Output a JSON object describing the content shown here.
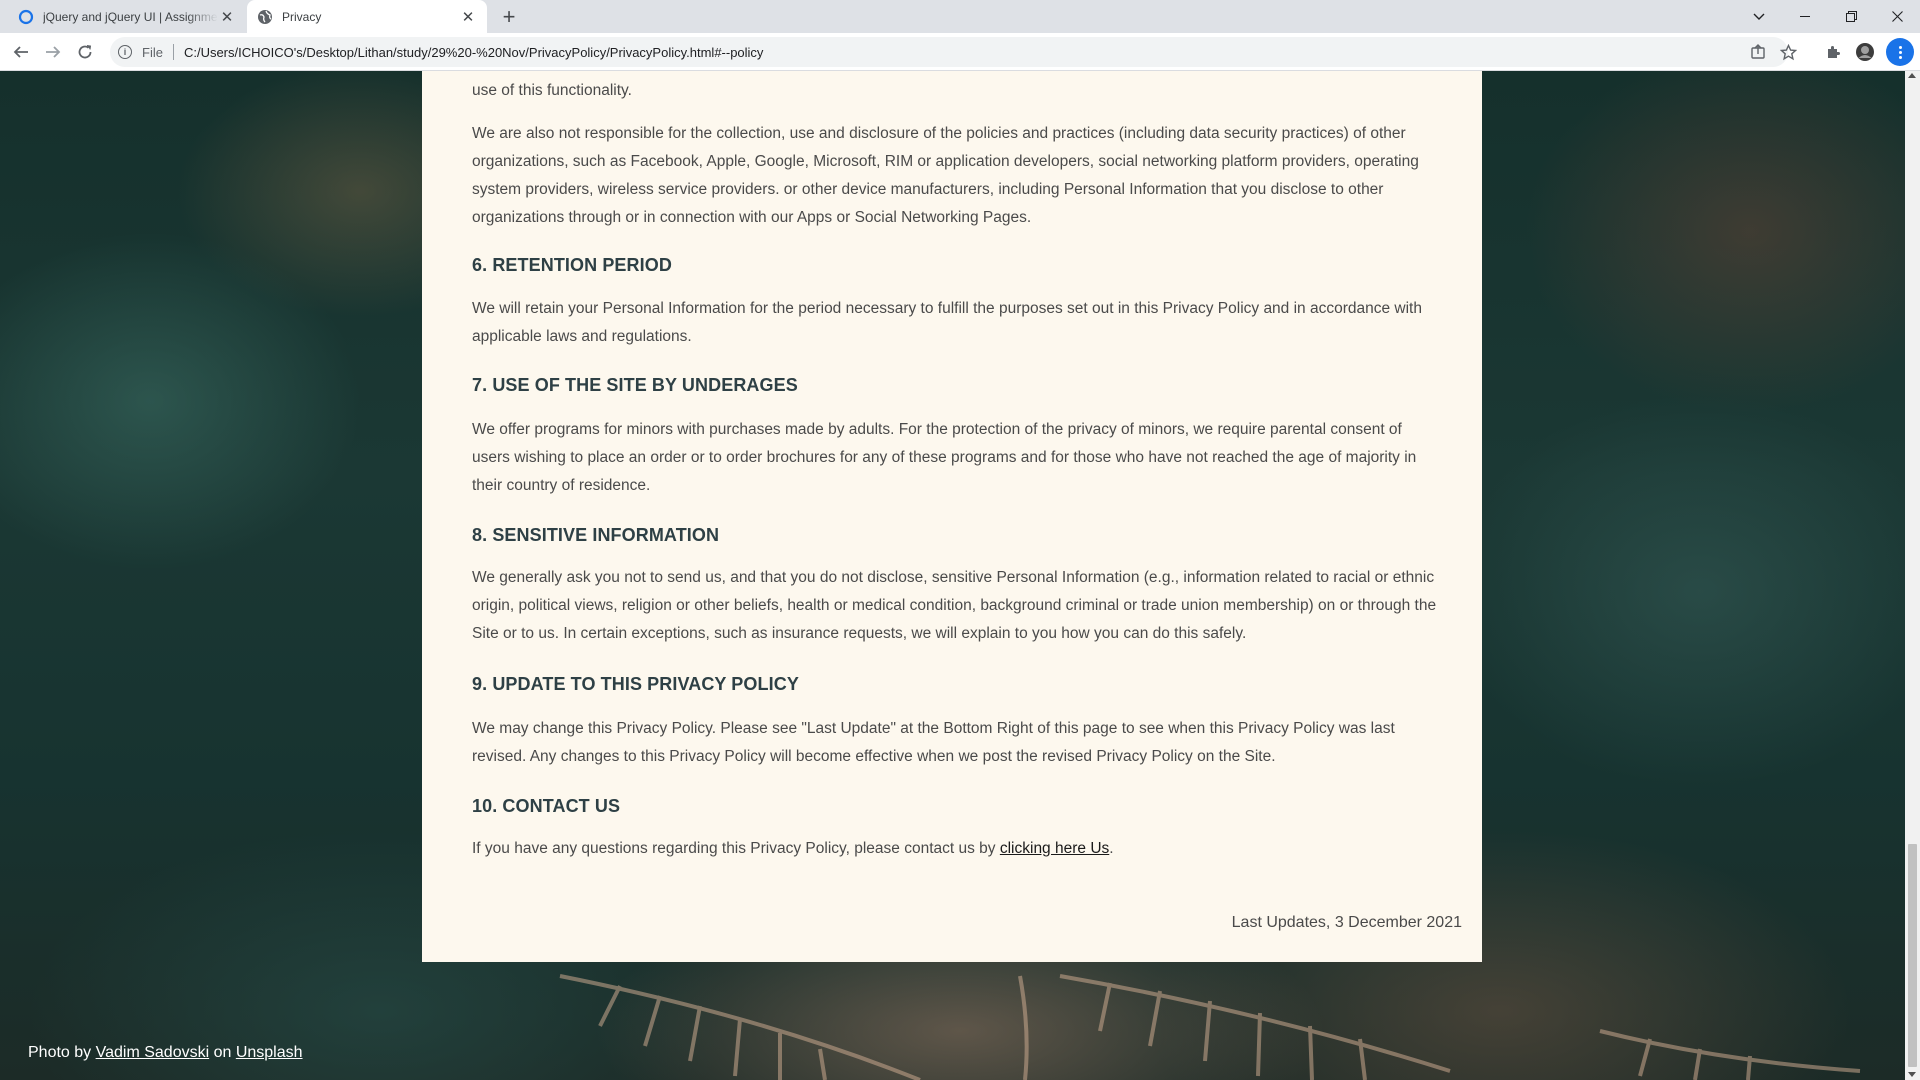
{
  "browser": {
    "tabs": [
      {
        "title": "jQuery and jQuery UI | Assignment",
        "icon": "circle-logo-icon",
        "active": false
      },
      {
        "title": "Privacy",
        "icon": "globe-icon",
        "active": true
      }
    ],
    "omnibox": {
      "scheme_label": "File",
      "url": "C:/Users/ICHOICO's/Desktop/Lithan/study/29%20-%20Nov/PrivacyPolicy/PrivacyPolicy.html#--policy"
    }
  },
  "page": {
    "intro_tail": "use of this functionality.",
    "intro_para": "We are also not responsible for the collection, use and disclosure of the policies and practices (including data security practices) of other organizations, such as Facebook, Apple, Google, Microsoft, RIM or application developers, social networking platform providers, operating system providers, wireless service providers. or other device manufacturers, including Personal Information that you disclose to other organizations through or in connection with our Apps or Social Networking Pages.",
    "sections": [
      {
        "heading": "6. RETENTION PERIOD",
        "body": "We will retain your Personal Information for the period necessary to fulfill the purposes set out in this Privacy Policy and in accordance with applicable laws and regulations."
      },
      {
        "heading": "7. USE OF THE SITE BY UNDERAGES",
        "body": "We offer programs for minors with purchases made by adults. For the protection of the privacy of minors, we require parental consent of users wishing to place an order or to order brochures for any of these programs and for those who have not reached the age of majority in their country of residence."
      },
      {
        "heading": "8. SENSITIVE INFORMATION",
        "body": "We generally ask you not to send us, and that you do not disclose, sensitive Personal Information (e.g., information related to racial or ethnic origin, political views, religion or other beliefs, health or medical condition, background criminal or trade union membership) on or through the Site or to us. In certain exceptions, such as insurance requests, we will explain to you how you can do this safely."
      },
      {
        "heading": "9. UPDATE TO THIS PRIVACY POLICY",
        "body": "We may change this Privacy Policy. Please see \"Last Update\" at the Bottom Right of this page to see when this Privacy Policy was last revised. Any changes to this Privacy Policy will become effective when we post the revised Privacy Policy on the Site."
      },
      {
        "heading": "10. CONTACT US",
        "body_prefix": "If you have any questions regarding this Privacy Policy, please contact us by ",
        "link_text": "clicking here Us",
        "body_suffix": "."
      }
    ],
    "last_updates": "Last Updates, 3 December 2021"
  },
  "credit": {
    "prefix": "Photo by ",
    "author": "Vadim Sadovski",
    "middle": " on ",
    "site": "Unsplash"
  },
  "colors": {
    "card_background": "#fdf8ee",
    "heading": "#2e4045",
    "body_text": "#4a4a4a",
    "chrome_accent": "#1a73e8"
  }
}
